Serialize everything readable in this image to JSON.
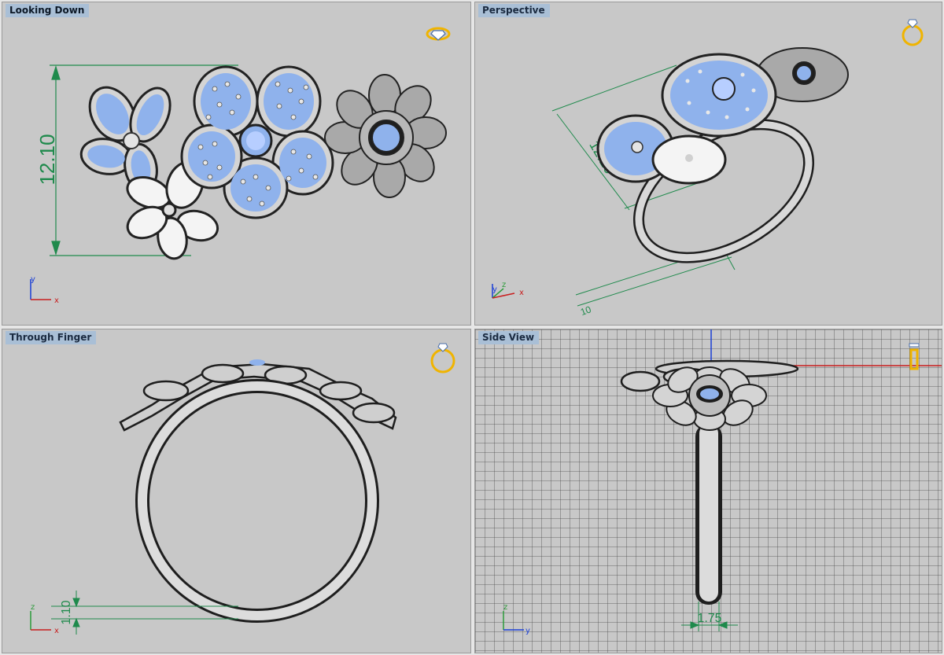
{
  "viewports": {
    "top_left": {
      "title": "Looking Down",
      "dimension": "12.10",
      "axes": {
        "vertical": "y",
        "horizontal": "x"
      }
    },
    "top_right": {
      "title": "Perspective",
      "dimension": "12.10",
      "dimension_small": "10",
      "axes": {
        "a": "y",
        "b": "z",
        "c": "x"
      }
    },
    "bottom_left": {
      "title": "Through Finger",
      "dimension": "1.10",
      "axes": {
        "vertical": "z",
        "horizontal": "x"
      }
    },
    "bottom_right": {
      "title": "Side View",
      "dimension": "1.75",
      "axes": {
        "vertical": "z",
        "horizontal": "y"
      }
    }
  },
  "colors": {
    "background": "#c8c8c8",
    "metal": "#d4d4d4",
    "gem": "#8fb2ec",
    "dimension": "#1f8a4c",
    "grid": "#4a4a4a",
    "icon": "#f0b400"
  },
  "icons": {
    "ring_icon": "ring-icon",
    "gem_icon": "diamond-icon"
  }
}
